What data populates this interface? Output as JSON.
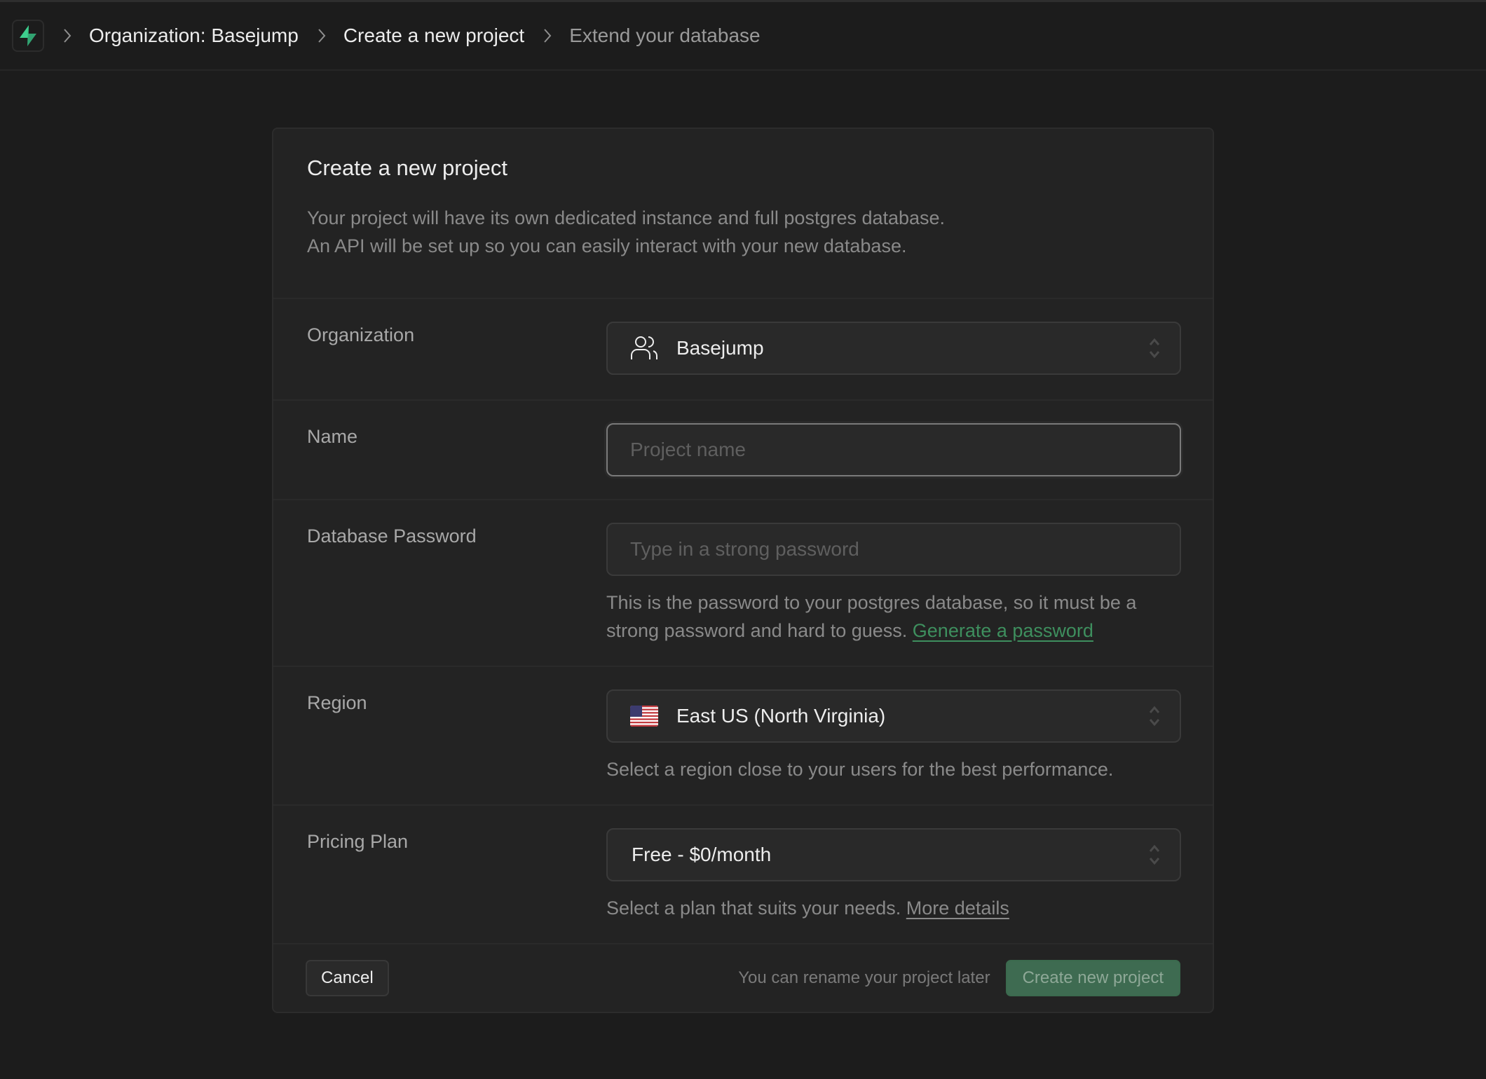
{
  "breadcrumb": {
    "items": [
      {
        "label": "Organization: Basejump"
      },
      {
        "label": "Create a new project"
      },
      {
        "label": "Extend your database"
      }
    ]
  },
  "card": {
    "title": "Create a new project",
    "description_line1": "Your project will have its own dedicated instance and full postgres database.",
    "description_line2": "An API will be set up so you can easily interact with your new database."
  },
  "form": {
    "organization": {
      "label": "Organization",
      "icon": "users-icon",
      "value": "Basejump"
    },
    "name": {
      "label": "Name",
      "value": "",
      "placeholder": "Project name"
    },
    "password": {
      "label": "Database Password",
      "value": "",
      "placeholder": "Type in a strong password",
      "help_text": "This is the password to your postgres database, so it must be a strong password and hard to guess.",
      "generate_link": "Generate a password"
    },
    "region": {
      "label": "Region",
      "icon": "us-flag-icon",
      "value": "East US (North Virginia)",
      "help_text": "Select a region close to your users for the best performance."
    },
    "pricing": {
      "label": "Pricing Plan",
      "value": "Free - $0/month",
      "help_text": "Select a plan that suits your needs.",
      "details_link": "More details"
    }
  },
  "footer": {
    "cancel_label": "Cancel",
    "note": "You can rename your project later",
    "create_label": "Create new project"
  },
  "colors": {
    "brand": "#3ecf8e",
    "link_green": "#3e8f5e",
    "create_button": "#3e6b51"
  }
}
